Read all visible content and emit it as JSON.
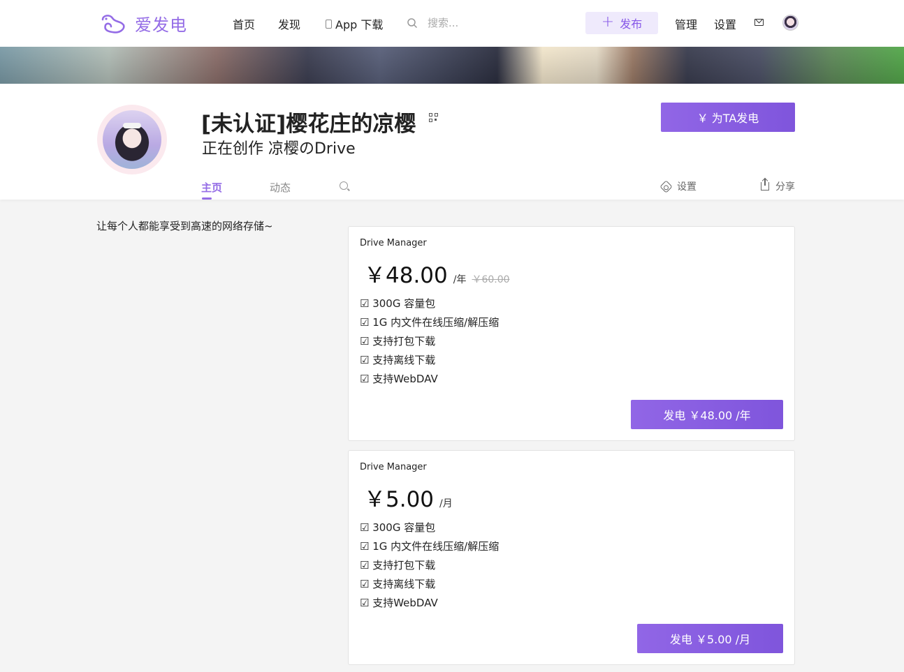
{
  "nav": {
    "logo_text": "爱发电",
    "links": [
      "首页",
      "发现",
      "App 下载"
    ],
    "search_placeholder": "搜索...",
    "publish_label": "发布",
    "manage_label": "管理",
    "settings_label": "设置",
    "accent_color": "#946ce6"
  },
  "profile": {
    "name": "[未认证]樱花庄的凉樱",
    "creating": "正在创作 凉樱のDrive",
    "support_button": "￥ 为TA发电",
    "tabs": [
      "主页",
      "动态"
    ],
    "active_tab": "主页",
    "settings_label": "设置",
    "share_label": "分享"
  },
  "about": "让每个人都能享受到高速的网络存储~",
  "plans": [
    {
      "name": "Drive Manager",
      "price": "￥48.00",
      "period": "/年",
      "original_price": "￥60.00",
      "features": [
        "☑ 300G 容量包",
        "☑ 1G 内文件在线压缩/解压缩",
        "☑ 支持打包下载",
        "☑ 支持离线下载",
        "☑ 支持WebDAV"
      ],
      "button": "发电 ￥48.00 /年"
    },
    {
      "name": "Drive Manager",
      "price": "￥5.00",
      "period": "/月",
      "features": [
        "☑ 300G 容量包",
        "☑ 1G 内文件在线压缩/解压缩",
        "☑ 支持打包下载",
        "☑ 支持离线下载",
        "☑ 支持WebDAV"
      ],
      "button": "发电 ￥5.00 /月"
    }
  ]
}
